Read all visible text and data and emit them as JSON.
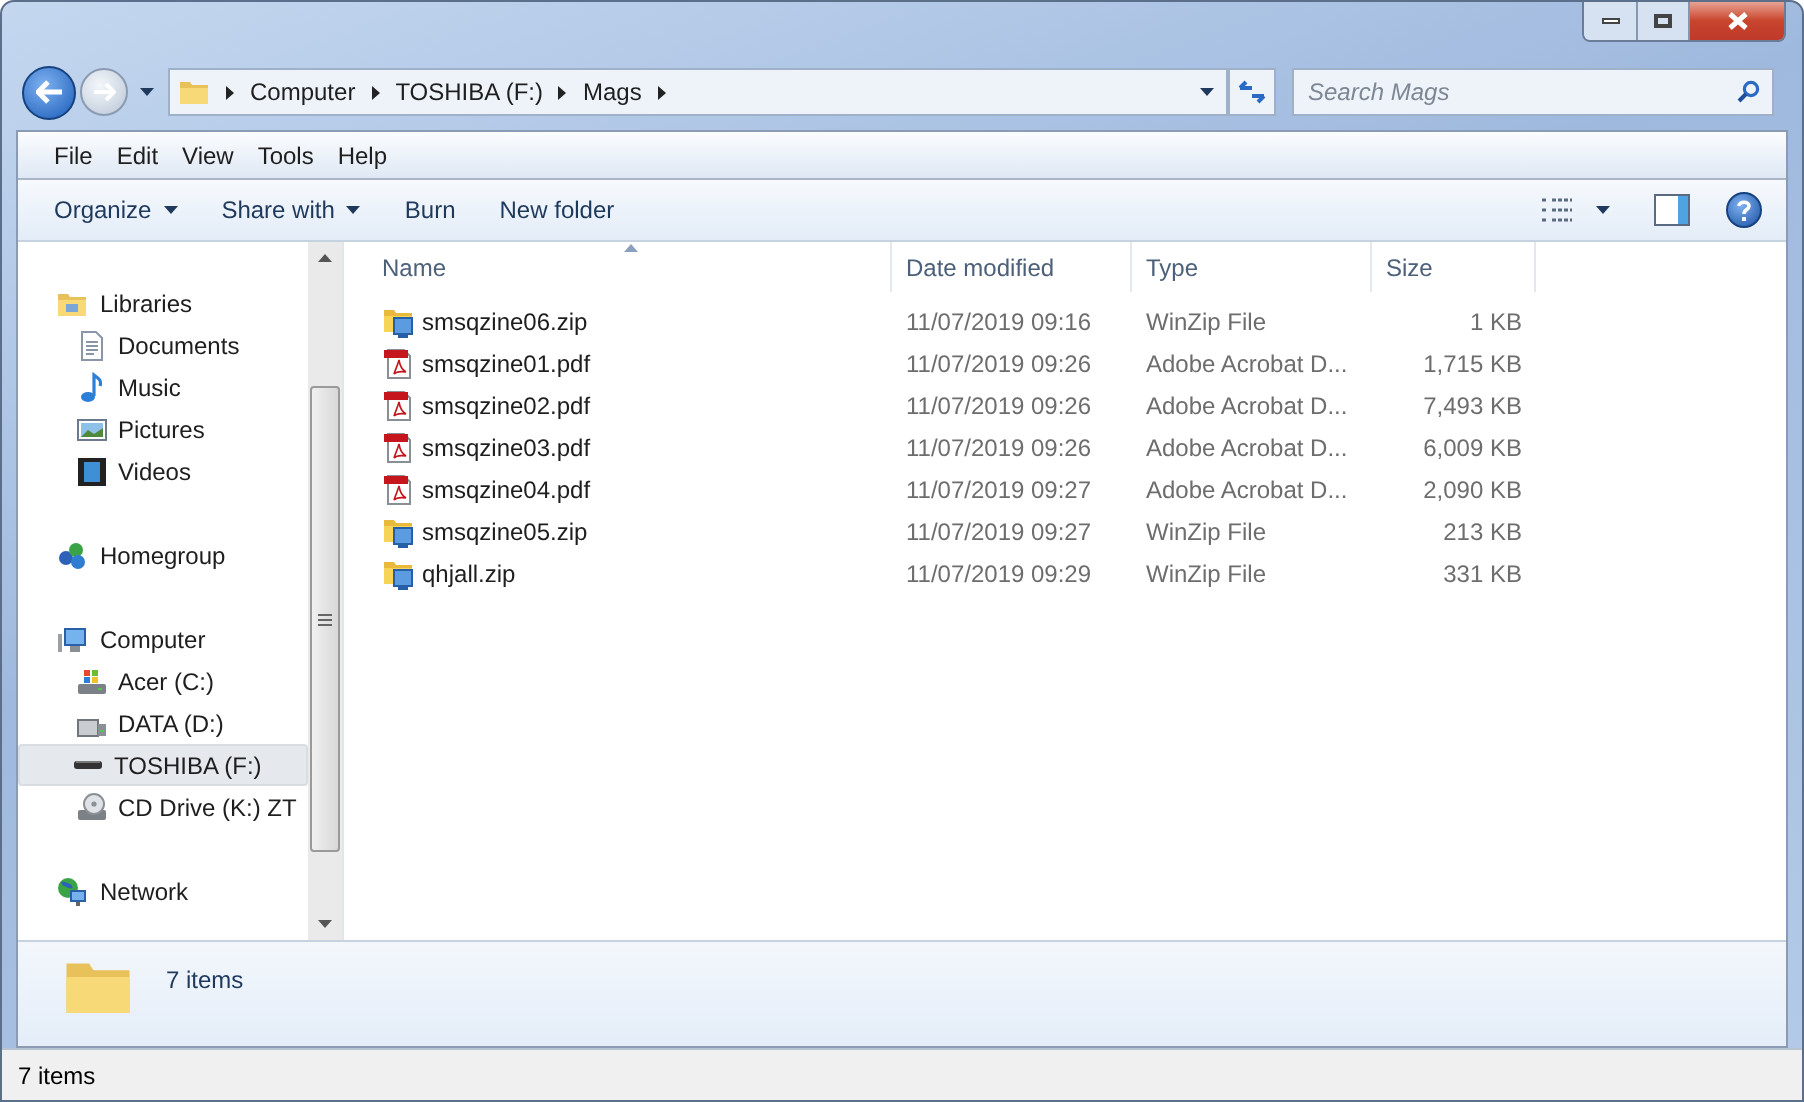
{
  "address_bar": {
    "crumbs": [
      "Computer",
      "TOSHIBA (F:)",
      "Mags"
    ]
  },
  "search": {
    "placeholder": "Search Mags"
  },
  "menu_bar": [
    "File",
    "Edit",
    "View",
    "Tools",
    "Help"
  ],
  "toolbar": [
    {
      "label": "Organize",
      "dropdown": true
    },
    {
      "label": "Share with",
      "dropdown": true
    },
    {
      "label": "Burn",
      "dropdown": false
    },
    {
      "label": "New folder",
      "dropdown": false
    }
  ],
  "sidebar": {
    "groups": [
      {
        "label": "Libraries",
        "kind": "libraries",
        "selected": false,
        "children": [
          {
            "label": "Documents",
            "kind": "documents",
            "selected": false
          },
          {
            "label": "Music",
            "kind": "music",
            "selected": false
          },
          {
            "label": "Pictures",
            "kind": "pictures",
            "selected": false
          },
          {
            "label": "Videos",
            "kind": "videos",
            "selected": false
          }
        ]
      },
      {
        "label": "Homegroup",
        "kind": "homegroup",
        "selected": false
      },
      {
        "label": "Computer",
        "kind": "computer",
        "selected": false,
        "children": [
          {
            "label": "Acer (C:)",
            "kind": "system-drive",
            "selected": false
          },
          {
            "label": "DATA (D:)",
            "kind": "drive",
            "selected": false
          },
          {
            "label": "TOSHIBA (F:)",
            "kind": "usb-drive",
            "selected": true
          },
          {
            "label": "CD Drive (K:) ZT",
            "kind": "cd-drive",
            "selected": false
          }
        ]
      },
      {
        "label": "Network",
        "kind": "network",
        "selected": false
      }
    ]
  },
  "table": {
    "columns": [
      "Name",
      "Date modified",
      "Type",
      "Size"
    ],
    "rows": [
      {
        "kind": "zip",
        "name": "smsqzine06.zip",
        "date": "11/07/2019 09:16",
        "type": "WinZip File",
        "size": "1 KB"
      },
      {
        "kind": "pdf",
        "name": "smsqzine01.pdf",
        "date": "11/07/2019 09:26",
        "type": "Adobe Acrobat D...",
        "size": "1,715 KB"
      },
      {
        "kind": "pdf",
        "name": "smsqzine02.pdf",
        "date": "11/07/2019 09:26",
        "type": "Adobe Acrobat D...",
        "size": "7,493 KB"
      },
      {
        "kind": "pdf",
        "name": "smsqzine03.pdf",
        "date": "11/07/2019 09:26",
        "type": "Adobe Acrobat D...",
        "size": "6,009 KB"
      },
      {
        "kind": "pdf",
        "name": "smsqzine04.pdf",
        "date": "11/07/2019 09:27",
        "type": "Adobe Acrobat D...",
        "size": "2,090 KB"
      },
      {
        "kind": "zip",
        "name": "smsqzine05.zip",
        "date": "11/07/2019 09:27",
        "type": "WinZip File",
        "size": "213 KB"
      },
      {
        "kind": "zip",
        "name": "qhjall.zip",
        "date": "11/07/2019 09:29",
        "type": "WinZip File",
        "size": "331 KB"
      }
    ]
  },
  "details_pane": {
    "count": "7 items"
  },
  "status_bar": {
    "count": "7 items"
  }
}
